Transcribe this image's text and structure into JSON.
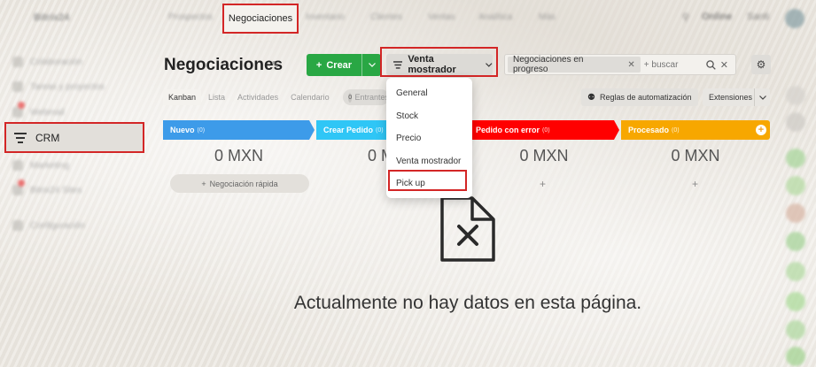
{
  "topbar": {
    "logo": "Bitrix24",
    "menu": [
      "Prospectos",
      "Inventario",
      "Clientes",
      "Ventas",
      "Analítica",
      "Más"
    ],
    "active_item": "Negociaciones",
    "right": [
      "Online",
      "Santi"
    ]
  },
  "sidebar": {
    "items": [
      "Colaboración",
      "Tareas y proyectos",
      "Webmail",
      "Marketing",
      "Bitrix24 Sites",
      "Configuración"
    ],
    "crm_label": "CRM"
  },
  "page": {
    "title": "Negociaciones",
    "create_label": "Crear",
    "funnel_label": "Venta mostrador",
    "filter_chip": "Negociaciones en progreso",
    "search_placeholder": "+ buscar"
  },
  "view_tabs": [
    "Kanban",
    "Lista",
    "Actividades",
    "Calendario"
  ],
  "entrance": {
    "count": "0",
    "label": "Entrantes"
  },
  "automation_label": "Reglas de automatización",
  "extensions_label": "Extensiones",
  "stages": [
    {
      "name": "Nuevo",
      "count": "(0)",
      "color": "#3d9be9",
      "sum": "0 MXN"
    },
    {
      "name": "Crear Pedido",
      "count": "(0)",
      "color": "#2fc6f6",
      "sum": "0 MXN"
    },
    {
      "name": "Pedido con error",
      "count": "(0)",
      "color": "#ff0000",
      "sum": "0 MXN"
    },
    {
      "name": "Procesado",
      "count": "(0)",
      "color": "#f7a700",
      "sum": "0 MXN"
    }
  ],
  "quick_deal": "Negociación rápida",
  "funnel_dropdown": [
    "General",
    "Stock",
    "Precio",
    "Venta mostrador",
    "Pick up"
  ],
  "empty_state": "Actualmente no hay datos en esta página.",
  "colors": {
    "accent_red": "#d32626",
    "create_green": "#29a744"
  }
}
